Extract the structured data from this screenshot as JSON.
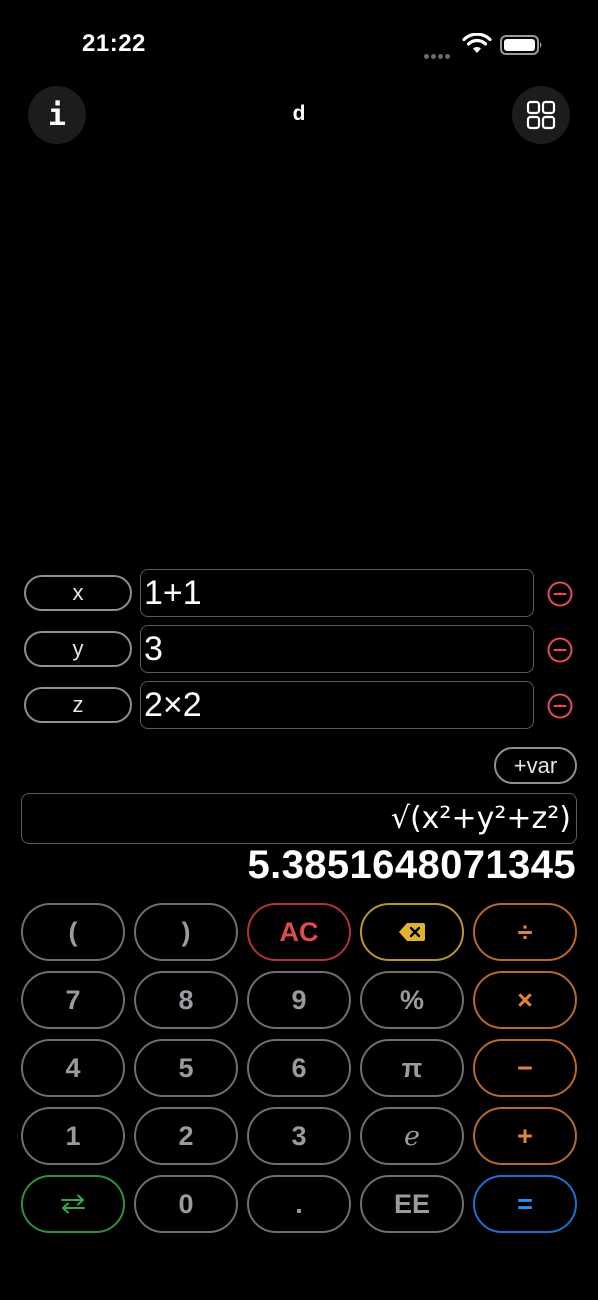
{
  "status_bar": {
    "time": "21:22",
    "icons": [
      "signal-dots-icon",
      "wifi-icon",
      "battery-icon"
    ]
  },
  "header": {
    "title": "d",
    "info_label": "i",
    "info_icon": "info-icon",
    "grid_icon": "grid-icon"
  },
  "variables": [
    {
      "name": "x",
      "value": "1+1"
    },
    {
      "name": "y",
      "value": "3"
    },
    {
      "name": "z",
      "value": "2×2"
    }
  ],
  "add_var_label": "+var",
  "formula": "√(x²+y²+z²)",
  "result": "5.3851648071345",
  "keypad": {
    "rows": [
      [
        {
          "label": "(",
          "style": "gray"
        },
        {
          "label": ")",
          "style": "gray"
        },
        {
          "label": "AC",
          "style": "red"
        },
        {
          "label": "",
          "style": "yellow",
          "icon": "backspace-icon"
        },
        {
          "label": "÷",
          "style": "orange"
        }
      ],
      [
        {
          "label": "7",
          "style": "gray"
        },
        {
          "label": "8",
          "style": "gray"
        },
        {
          "label": "9",
          "style": "gray"
        },
        {
          "label": "%",
          "style": "gray"
        },
        {
          "label": "×",
          "style": "orange"
        }
      ],
      [
        {
          "label": "4",
          "style": "gray"
        },
        {
          "label": "5",
          "style": "gray"
        },
        {
          "label": "6",
          "style": "gray"
        },
        {
          "label": "π",
          "style": "gray"
        },
        {
          "label": "−",
          "style": "orange"
        }
      ],
      [
        {
          "label": "1",
          "style": "gray"
        },
        {
          "label": "2",
          "style": "gray"
        },
        {
          "label": "3",
          "style": "gray"
        },
        {
          "label": "e",
          "style": "gray"
        },
        {
          "label": "+",
          "style": "orange"
        }
      ],
      [
        {
          "label": "",
          "style": "green",
          "icon": "swap-arrows-icon"
        },
        {
          "label": "0",
          "style": "gray"
        },
        {
          "label": ".",
          "style": "gray"
        },
        {
          "label": "EE",
          "style": "gray"
        },
        {
          "label": "=",
          "style": "blue"
        }
      ]
    ]
  },
  "colors": {
    "background": "#000000",
    "delete_red": "#e04a52",
    "ac_red": "#e04a52",
    "backspace_yellow": "#dfb52f",
    "operator_orange": "#e3843a",
    "swap_green": "#35a94a",
    "equals_blue": "#2d8df2"
  }
}
